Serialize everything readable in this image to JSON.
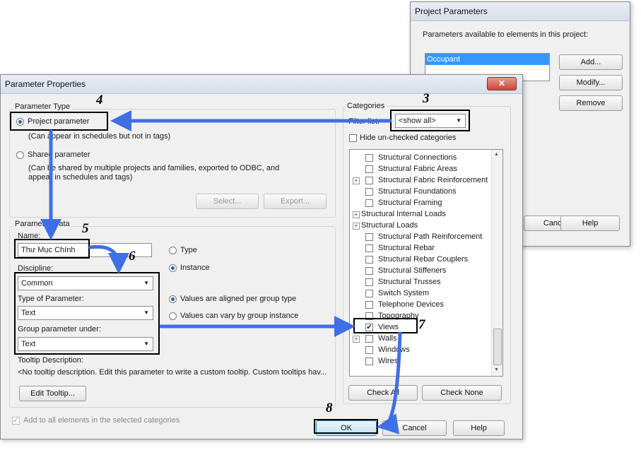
{
  "project_parameters": {
    "title": "Project Parameters",
    "available_label": "Parameters available to elements in this project:",
    "items": [
      "Occupant"
    ],
    "buttons": {
      "add": "Add...",
      "modify": "Modify...",
      "remove": "Remove",
      "cancel": "Cancel",
      "help": "Help"
    }
  },
  "parameter_properties": {
    "title": "Parameter Properties",
    "parameter_type": {
      "group_label": "Parameter Type",
      "project_parameter": "Project parameter",
      "project_desc": "(Can appear in schedules but not in tags)",
      "shared_parameter": "Shared parameter",
      "shared_desc_1": "(Can be shared by multiple projects and families, exported to ODBC, and",
      "shared_desc_2": "appear in schedules and tags)",
      "select_button": "Select...",
      "export_button": "Export..."
    },
    "parameter_data": {
      "group_label": "Parameter Data",
      "name_label": "Name:",
      "name_value": "Thư Mục Chính",
      "type_option": "Type",
      "instance_option": "Instance",
      "discipline_label": "Discipline:",
      "discipline_value": "Common",
      "type_of_parameter_label": "Type of Parameter:",
      "type_of_parameter_value": "Text",
      "group_under_label": "Group parameter under:",
      "group_under_value": "Text",
      "aligned_option": "Values are aligned per group type",
      "vary_option": "Values can vary by group instance",
      "tooltip_label": "Tooltip Description:",
      "tooltip_text": "<No tooltip description. Edit this parameter to write a custom tooltip. Custom tooltips hav...",
      "edit_tooltip_button": "Edit Tooltip..."
    },
    "add_all_label": "Add to all elements in the selected categories",
    "categories": {
      "group_label": "Categories",
      "filter_label": "Filter list:",
      "filter_value": "<show all>",
      "hide_unchecked": "Hide un-checked categories",
      "items": [
        {
          "label": "Structural Connections",
          "checked": false,
          "expandable": false,
          "level": 1
        },
        {
          "label": "Structural Fabric Areas",
          "checked": false,
          "expandable": false,
          "level": 1
        },
        {
          "label": "Structural Fabric Reinforcement",
          "checked": false,
          "expandable": true,
          "level": 1
        },
        {
          "label": "Structural Foundations",
          "checked": false,
          "expandable": false,
          "level": 1
        },
        {
          "label": "Structural Framing",
          "checked": false,
          "expandable": false,
          "level": 1
        },
        {
          "label": "Structural Internal Loads",
          "checked": false,
          "expandable": true,
          "level": 0
        },
        {
          "label": "Structural Loads",
          "checked": false,
          "expandable": true,
          "level": 0
        },
        {
          "label": "Structural Path Reinforcement",
          "checked": false,
          "expandable": false,
          "level": 1
        },
        {
          "label": "Structural Rebar",
          "checked": false,
          "expandable": false,
          "level": 1
        },
        {
          "label": "Structural Rebar Couplers",
          "checked": false,
          "expandable": false,
          "level": 1
        },
        {
          "label": "Structural Stiffeners",
          "checked": false,
          "expandable": false,
          "level": 1
        },
        {
          "label": "Structural Trusses",
          "checked": false,
          "expandable": false,
          "level": 1
        },
        {
          "label": "Switch System",
          "checked": false,
          "expandable": false,
          "level": 1
        },
        {
          "label": "Telephone Devices",
          "checked": false,
          "expandable": false,
          "level": 1
        },
        {
          "label": "Topography",
          "checked": false,
          "expandable": false,
          "level": 1
        },
        {
          "label": "Views",
          "checked": true,
          "expandable": false,
          "level": 1
        },
        {
          "label": "Walls",
          "checked": false,
          "expandable": true,
          "level": 1
        },
        {
          "label": "Windows",
          "checked": false,
          "expandable": false,
          "level": 1
        },
        {
          "label": "Wires",
          "checked": false,
          "expandable": false,
          "level": 1
        }
      ],
      "check_all_button": "Check All",
      "check_none_button": "Check None"
    },
    "ok_button": "OK",
    "cancel_button": "Cancel",
    "help_button": "Help"
  },
  "annotations": [
    "3",
    "4",
    "5",
    "6",
    "7",
    "8"
  ],
  "colors": {
    "arrow": "#3f6fe6",
    "selection": "#3399ff"
  }
}
